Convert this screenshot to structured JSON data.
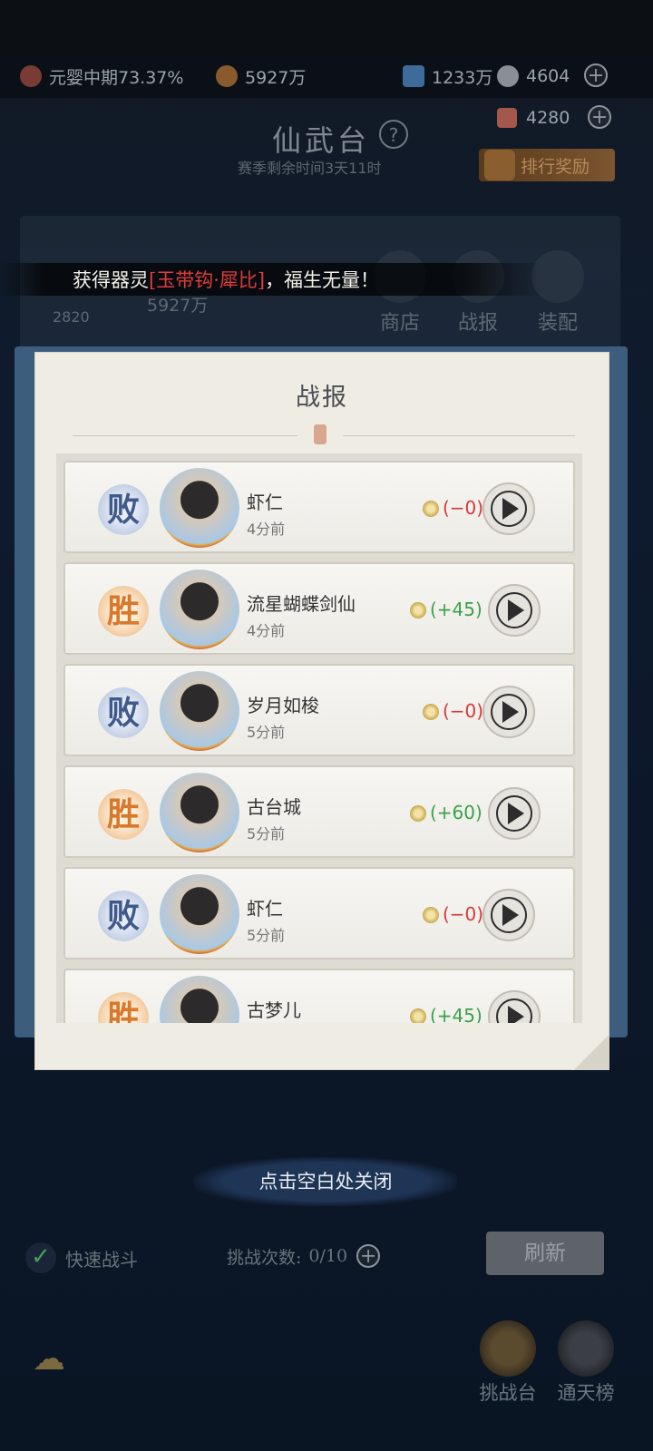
{
  "status_bar": {
    "realm_text": "元婴中期73.37%",
    "power_text": "5927万",
    "jade_text": "1233万",
    "spirit_text": "4604",
    "tickets_text": "4280"
  },
  "header": {
    "title": "仙武台",
    "help_glyph": "?",
    "season_text": "赛季剩余时间3天11时",
    "rank_reward_label": "排行奖励"
  },
  "background_panel": {
    "coin_text": "2820",
    "power_text": "5927万",
    "shop_label": "商店",
    "report_label": "战报",
    "equip_label": "装配"
  },
  "toast": {
    "prefix": "获得器灵",
    "item": "[玉带钩·犀比]",
    "suffix": "，福生无量！"
  },
  "battle_report": {
    "title": "战报",
    "rows": [
      {
        "result": "败",
        "name": "虾仁",
        "time": "4分前",
        "delta": "(−0)"
      },
      {
        "result": "胜",
        "name": "流星蝴蝶剑仙",
        "time": "4分前",
        "delta": "(+45)"
      },
      {
        "result": "败",
        "name": "岁月如梭",
        "time": "5分前",
        "delta": "(−0)"
      },
      {
        "result": "胜",
        "name": "古台城",
        "time": "5分前",
        "delta": "(+60)"
      },
      {
        "result": "败",
        "name": "虾仁",
        "time": "5分前",
        "delta": "(−0)"
      },
      {
        "result": "胜",
        "name": "古梦儿",
        "time": "",
        "delta": "(+45)"
      }
    ]
  },
  "footer": {
    "close_hint": "点击空白处关闭",
    "quick_battle_label": "快速战斗",
    "challenge_label": "挑战次数:",
    "challenge_count": "0/10",
    "refresh_label": "刷新",
    "nav_challenge": "挑战台",
    "nav_tower": "通天榜"
  },
  "colors": {
    "win": "#d8782a",
    "lose": "#3f5a8a",
    "gain": "#3aa04a",
    "loss": "#d23a3a",
    "toast_highlight": "#e23b3b"
  },
  "icons": [
    "realm-icon",
    "power-icon",
    "jade-icon",
    "spirit-icon",
    "ticket-icon",
    "plus-icon",
    "help-icon",
    "gift-icon",
    "coin-icon",
    "play-icon",
    "check-icon",
    "cloud-icon"
  ]
}
